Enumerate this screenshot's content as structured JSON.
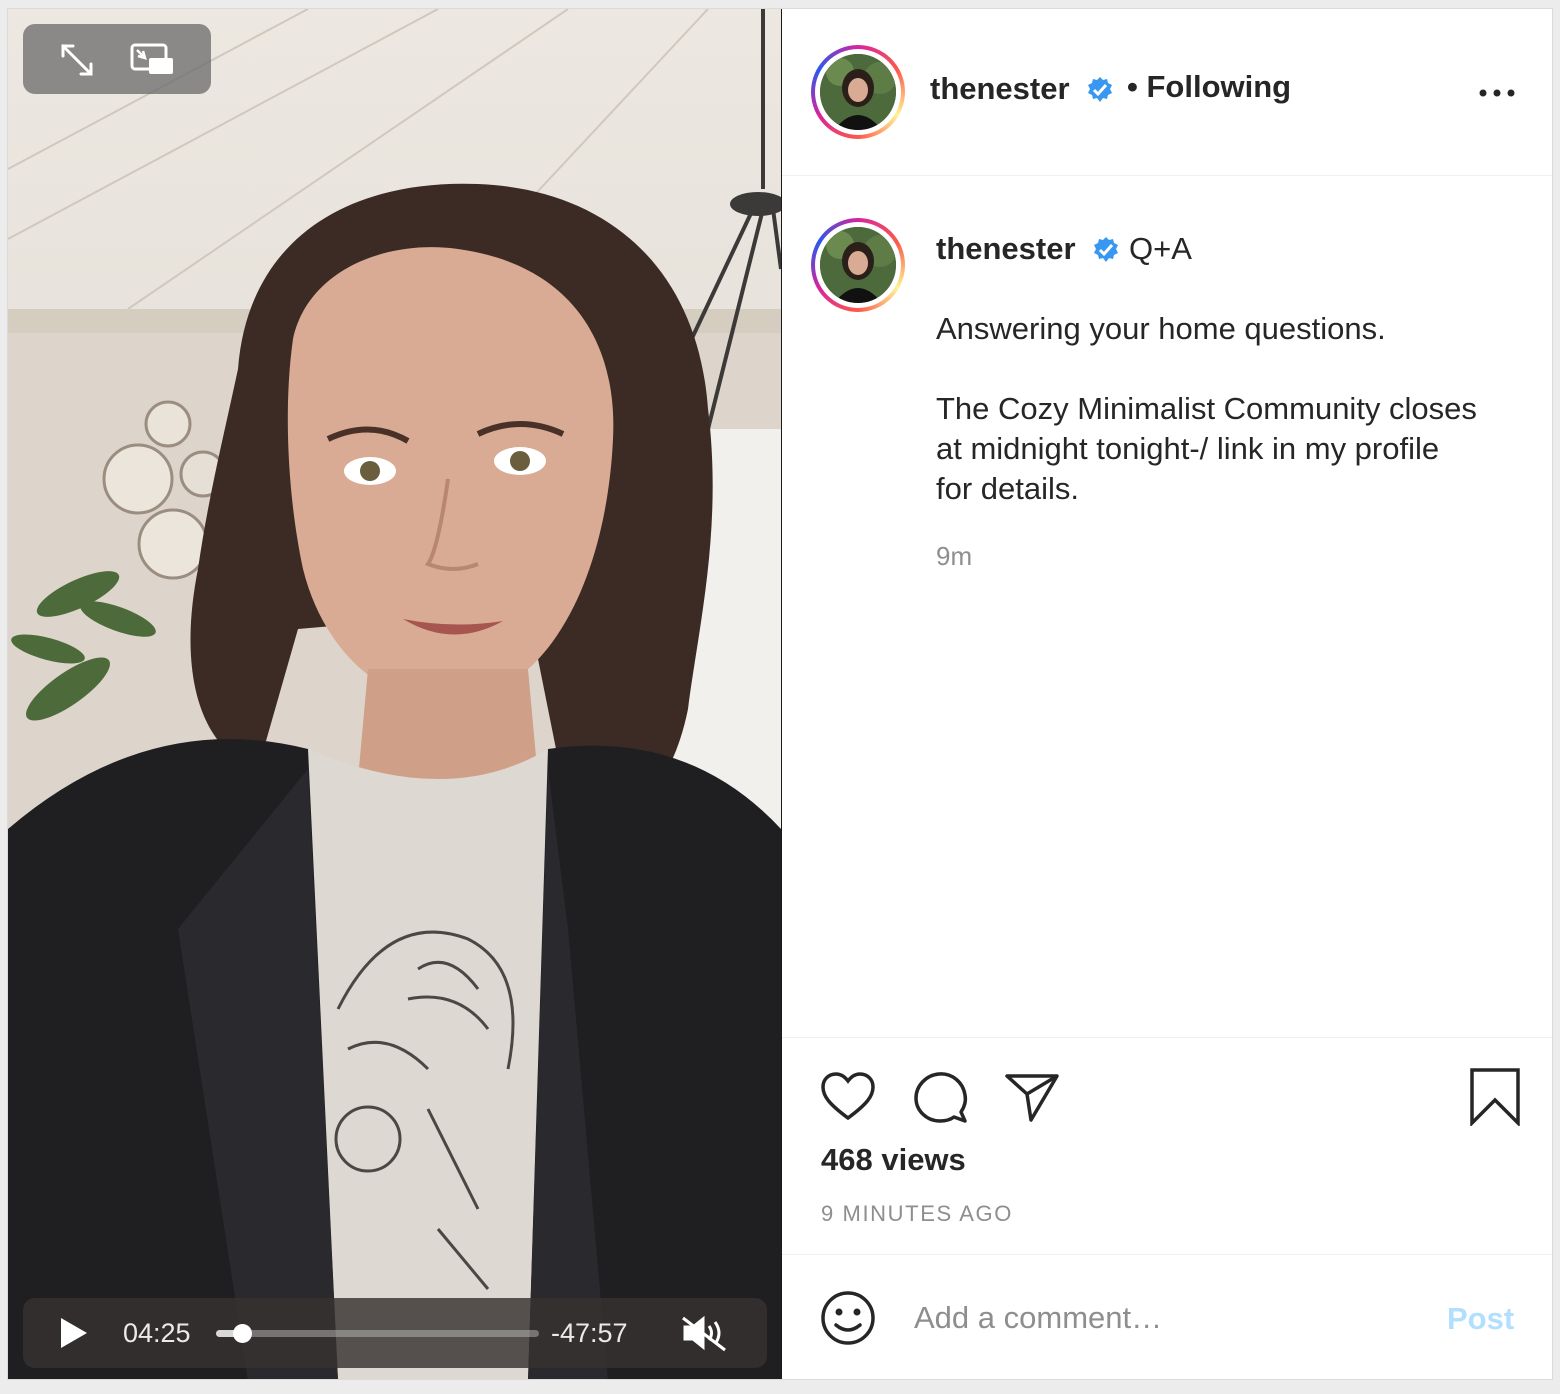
{
  "video": {
    "time_current": "04:25",
    "time_remaining": "-47:57",
    "progress": 0.08,
    "muted": true
  },
  "header": {
    "username": "thenester",
    "follow_state": "• Following"
  },
  "caption": {
    "username": "thenester",
    "tag": "Q+A",
    "lines": [
      "Answering your home questions.",
      "The Cozy Minimalist Community closes",
      "at midnight tonight-/ link in my profile",
      "for details."
    ],
    "time": "9m"
  },
  "stats": {
    "views": "468 views",
    "posted": "9 MINUTES AGO"
  },
  "comment": {
    "placeholder": "Add a comment…",
    "post_label": "Post"
  },
  "colors": {
    "verified": "#3897f0",
    "post_disabled": "#b2dffc",
    "text": "#262626",
    "muted": "#8e8e8e"
  },
  "icons": [
    "expand-icon",
    "picture-in-picture-icon",
    "play-icon",
    "muted-speaker-icon",
    "more-options-icon",
    "verified-badge-icon",
    "heart-icon",
    "comment-icon",
    "share-icon",
    "bookmark-icon",
    "emoji-icon"
  ]
}
